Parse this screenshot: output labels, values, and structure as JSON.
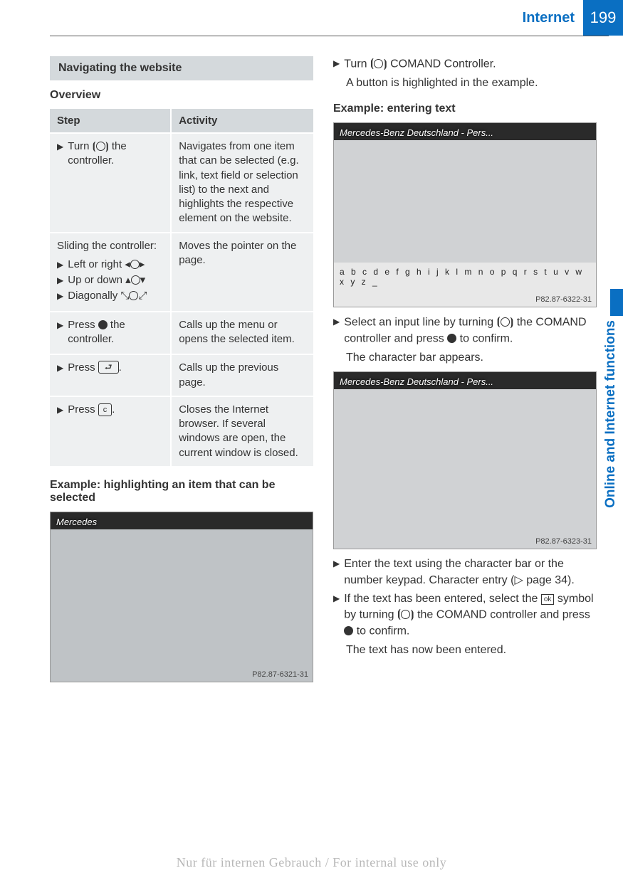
{
  "header": {
    "title": "Internet",
    "page": "199"
  },
  "sidebar": {
    "label": "Online and Internet functions"
  },
  "left": {
    "banner": "Navigating the website",
    "overview_heading": "Overview",
    "table": {
      "headers": [
        "Step",
        "Activity"
      ],
      "rows": [
        {
          "step_prefix": "Turn",
          "step_suffix": "the controller.",
          "activity": "Navigates from one item that can be selected (e.g. link, text field or selection list) to the next and highlights the respective element on the website."
        },
        {
          "intro": "Sliding the controller:",
          "lines": [
            "Left or right",
            "Up or down",
            "Diagonally"
          ],
          "activity": "Moves the pointer on the page."
        },
        {
          "step_prefix": "Press",
          "step_suffix": "the controller.",
          "activity": "Calls up the menu or opens the selected item."
        },
        {
          "step_prefix": "Press",
          "step_suffix": ".",
          "activity": "Calls up the previous page."
        },
        {
          "step_prefix": "Press",
          "step_suffix": ".",
          "activity": "Closes the Internet browser. If several windows are open, the current window is closed."
        }
      ]
    },
    "example_heading": "Example: highlighting an item that can be selected",
    "img1": {
      "title": "Mercedes",
      "caption": "P82.87-6321-31"
    }
  },
  "right": {
    "step1_prefix": "Turn",
    "step1_suffix": "COMAND Controller.",
    "step1_sub": "A button is highlighted in the example.",
    "heading2": "Example: entering text",
    "img2": {
      "title": "Mercedes-Benz Deutschland - Pers...",
      "caption": "P82.87-6322-31",
      "chars": "a b c d e f g h i j k l m n o p q r s t u v w x y z _"
    },
    "step2_a": "Select an input line by turning",
    "step2_b": "the COMAND controller and press",
    "step2_c": "to confirm.",
    "step2_sub": "The character bar appears.",
    "img3": {
      "title": "Mercedes-Benz Deutschland - Pers...",
      "caption": "P82.87-6323-31"
    },
    "step3": "Enter the text using the character bar or the number keypad. Character entry",
    "step3_ref": "(▷ page 34).",
    "step4_a": "If the text has been entered, select the",
    "step4_b": "symbol by turning",
    "step4_c": "the COMAND controller and press",
    "step4_d": "to confirm.",
    "step4_sub": "The text has now been entered."
  },
  "watermark": "Nur für internen Gebrauch / For internal use only",
  "glyphs": {
    "knob_turn": "⟲◎⟳",
    "press": "⊙",
    "back": "⮐",
    "c": "c",
    "ok": "ok"
  }
}
